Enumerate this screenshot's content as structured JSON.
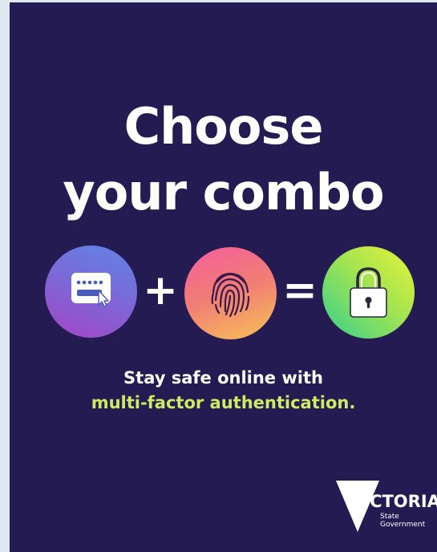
{
  "headline": {
    "line1": "Choose",
    "line2": "your combo"
  },
  "combo": {
    "items": [
      {
        "icon": "password-card-icon"
      },
      {
        "icon": "fingerprint-icon"
      },
      {
        "icon": "padlock-icon"
      }
    ],
    "plus": "+",
    "equals": "="
  },
  "tagline": {
    "line1": "Stay safe online with",
    "line2": "multi-factor authentication."
  },
  "logo": {
    "word": "VICTORIA",
    "sub1": "State",
    "sub2": "Government"
  },
  "colors": {
    "background": "#231b52",
    "accent_text": "#cdea62",
    "outer_frame": "#dfe9f2"
  }
}
